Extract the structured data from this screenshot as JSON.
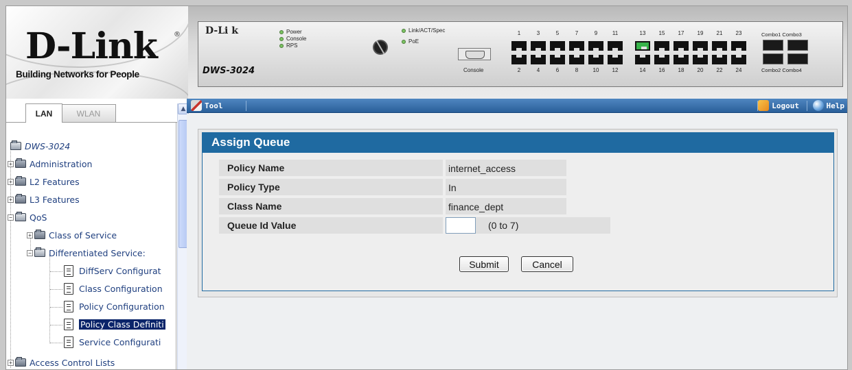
{
  "logo": {
    "brand": "D-Link",
    "trademark": "®",
    "tagline": "Building Networks for People"
  },
  "device": {
    "brand": "D-Li   k",
    "model": "DWS-3024",
    "leds_left": [
      "Power",
      "Console",
      "RPS"
    ],
    "leds_right": [
      "Link/ACT/Spec",
      "PoE"
    ],
    "console_label": "Console",
    "ports_top_odd": [
      "1",
      "3",
      "5",
      "7",
      "9",
      "11",
      "13",
      "15",
      "17",
      "19",
      "21",
      "23"
    ],
    "ports_bottom_even": [
      "2",
      "4",
      "6",
      "8",
      "10",
      "12",
      "14",
      "16",
      "18",
      "20",
      "22",
      "24"
    ],
    "combo_top": "Combo1 Combo3",
    "combo_bottom": "Combo2 Combo4"
  },
  "toolbar": {
    "tool_label": "Tool",
    "logout_label": "Logout",
    "help_label": "Help"
  },
  "tabs": {
    "lan": "LAN",
    "wlan": "WLAN"
  },
  "tree": {
    "root": "DWS-3024",
    "items": [
      {
        "label": "Administration"
      },
      {
        "label": "L2 Features"
      },
      {
        "label": "L3 Features"
      },
      {
        "label": "QoS"
      },
      {
        "label": "Class of Service"
      },
      {
        "label": "Differentiated Service:"
      },
      {
        "label": "DiffServ Configurat"
      },
      {
        "label": "Class Configuration"
      },
      {
        "label": "Policy Configuration"
      },
      {
        "label": "Policy Class Definiti"
      },
      {
        "label": "Service Configurati"
      },
      {
        "label": "Access Control Lists"
      }
    ]
  },
  "assign_queue": {
    "title": "Assign Queue",
    "fields": [
      {
        "label": "Policy Name",
        "value": "internet_access"
      },
      {
        "label": "Policy Type",
        "value": "In"
      },
      {
        "label": "Class Name",
        "value": "finance_dept"
      }
    ],
    "queue_id": {
      "label": "Queue Id Value",
      "value": "",
      "range_hint": "(0 to 7)"
    },
    "submit_label": "Submit",
    "cancel_label": "Cancel"
  },
  "colors": {
    "header_blue": "#1f6aa1",
    "toolbar_blue": "#2a5f9a",
    "selected_bg": "#0a246a"
  }
}
